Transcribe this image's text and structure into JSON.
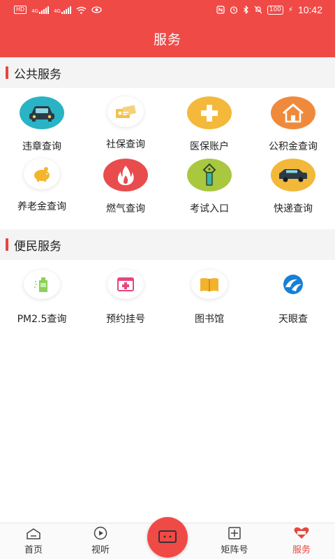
{
  "status_bar": {
    "left_badges": [
      "HD",
      "4G",
      "4G"
    ],
    "battery": "100",
    "time": "10:42"
  },
  "header": {
    "title": "服务"
  },
  "public_services": {
    "title": "公共服务",
    "items": [
      {
        "label": "违章查询",
        "icon": "car-icon",
        "color": "#2ab3c4"
      },
      {
        "label": "社保查询",
        "icon": "social-security-card-icon",
        "color": "#ffffff"
      },
      {
        "label": "医保账户",
        "icon": "medical-cross-icon",
        "color": "#f4b93a"
      },
      {
        "label": "公积金查询",
        "icon": "house-icon",
        "color": "#ef8a3c"
      },
      {
        "label": "养老金查询",
        "icon": "piggy-bank-icon",
        "color": "#ffffff"
      },
      {
        "label": "燃气查询",
        "icon": "flame-icon",
        "color": "#e94c4c"
      },
      {
        "label": "考试入口",
        "icon": "pen-icon",
        "color": "#a9c73f"
      },
      {
        "label": "快递查询",
        "icon": "delivery-van-icon",
        "color": "#f2b83a"
      }
    ]
  },
  "convenience_services": {
    "title": "便民服务",
    "items": [
      {
        "label": "PM2.5查询",
        "icon": "air-purifier-icon"
      },
      {
        "label": "预约挂号",
        "icon": "medical-kit-icon"
      },
      {
        "label": "图书馆",
        "icon": "book-icon"
      },
      {
        "label": "天眼查",
        "icon": "tianyancha-logo-icon"
      }
    ]
  },
  "tab_bar": {
    "items": [
      {
        "label": "首页",
        "icon": "home-icon"
      },
      {
        "label": "视听",
        "icon": "play-icon"
      },
      {
        "label": "矩阵号",
        "icon": "matrix-add-icon"
      },
      {
        "label": "服务",
        "icon": "service-heart-icon",
        "active": true
      }
    ],
    "center_icon": "chat-icon",
    "accent": "#e8453f"
  }
}
